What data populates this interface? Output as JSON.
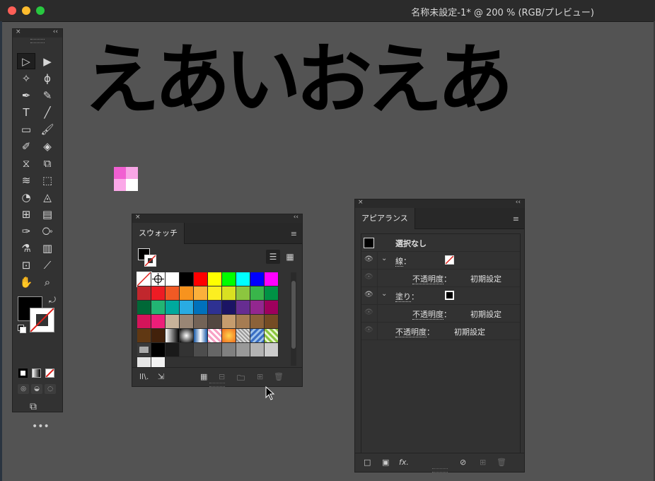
{
  "window": {
    "title": "名称未設定-1* @ 200 % (RGB/プレビュー)"
  },
  "canvas": {
    "text": "えあいおえあ",
    "pink_swatch_colors": [
      "#f15fd2",
      "#f8a6e6",
      "#fba8e8",
      "#ffffff"
    ]
  },
  "toolbar": {
    "close": "×",
    "collapse": "‹‹",
    "tools": [
      {
        "name": "selection-tool",
        "glyph": "▷"
      },
      {
        "name": "direct-selection-tool",
        "glyph": "▶"
      },
      {
        "name": "magic-wand-tool",
        "glyph": "✧"
      },
      {
        "name": "lasso-tool",
        "glyph": "ϕ"
      },
      {
        "name": "pen-tool",
        "glyph": "✒"
      },
      {
        "name": "curvature-tool",
        "glyph": "✎"
      },
      {
        "name": "type-tool",
        "glyph": "T"
      },
      {
        "name": "line-tool",
        "glyph": "╱"
      },
      {
        "name": "rectangle-tool",
        "glyph": "▭"
      },
      {
        "name": "paintbrush-tool",
        "glyph": "🖌"
      },
      {
        "name": "shaper-tool",
        "glyph": "✐"
      },
      {
        "name": "eraser-tool",
        "glyph": "◈"
      },
      {
        "name": "reflect-tool",
        "glyph": "⧖"
      },
      {
        "name": "scale-tool",
        "glyph": "⧉"
      },
      {
        "name": "width-tool",
        "glyph": "≋"
      },
      {
        "name": "free-transform-tool",
        "glyph": "⬚"
      },
      {
        "name": "shape-builder-tool",
        "glyph": "◔"
      },
      {
        "name": "perspective-grid-tool",
        "glyph": "◬"
      },
      {
        "name": "mesh-tool",
        "glyph": "⊞"
      },
      {
        "name": "gradient-tool",
        "glyph": "▤"
      },
      {
        "name": "eyedropper-tool",
        "glyph": "✑"
      },
      {
        "name": "blend-tool",
        "glyph": "⧂"
      },
      {
        "name": "symbol-sprayer-tool",
        "glyph": "⚗"
      },
      {
        "name": "column-graph-tool",
        "glyph": "▥"
      },
      {
        "name": "artboard-tool",
        "glyph": "⊡"
      },
      {
        "name": "slice-tool",
        "glyph": "⟋"
      },
      {
        "name": "hand-tool",
        "glyph": "✋"
      },
      {
        "name": "zoom-tool",
        "glyph": "⌕"
      }
    ],
    "more": "•••"
  },
  "swatches": {
    "close": "×",
    "collapse": "‹‹",
    "tab": "スウォッチ",
    "menu": "≡",
    "colors": [
      "none",
      "reg",
      "#ffffff",
      "#000000",
      "#ff0000",
      "#ffff00",
      "#00ff00",
      "#00ffff",
      "#0000ff",
      "#ff00ff",
      "#c1272d",
      "#ed1c24",
      "#f15a24",
      "#f7931e",
      "#fbb03b",
      "#fcee21",
      "#d9e021",
      "#8cc63f",
      "#39b54a",
      "#009245",
      "#006837",
      "#22b573",
      "#00a99d",
      "#29abe2",
      "#0071bc",
      "#2e3192",
      "#1b1464",
      "#662d91",
      "#93278f",
      "#9e005d",
      "#d4145a",
      "#ed1e79",
      "#c7b299",
      "#998675",
      "#736357",
      "#534741",
      "#c69c6d",
      "#a67c52",
      "#8c6239",
      "#754c24",
      "#603813",
      "#42210b",
      "grad1",
      "grad2",
      "grad3",
      "pat1",
      "pat2",
      "pat3",
      "pat4",
      "pat5",
      "folder",
      "#000000",
      "#1a1a1a",
      "#333333",
      "#4d4d4d",
      "#666666",
      "#808080",
      "#999999",
      "#b3b3b3",
      "#cccccc",
      "#e6e6e6",
      "#f2f2f2"
    ],
    "footer_icons": [
      "ll\\.",
      "⇲",
      "▦",
      "⊟",
      "🗀",
      "⊞",
      "🗑"
    ]
  },
  "appearance": {
    "close": "×",
    "collapse": "‹‹",
    "tab": "アピアランス",
    "menu": "≡",
    "selection_label": "選択なし",
    "stroke_label": "線",
    "stroke_colon": "：",
    "opacity_label": "不透明度",
    "opacity_colon": "：",
    "opacity_value": "初期設定",
    "fill_label": "塗り",
    "fill_colon": "：",
    "opacity2_value": "初期設定",
    "obj_opacity_label": "不透明度",
    "obj_opacity_colon": "：",
    "obj_opacity_value": "初期設定",
    "fx_label": "fx."
  }
}
